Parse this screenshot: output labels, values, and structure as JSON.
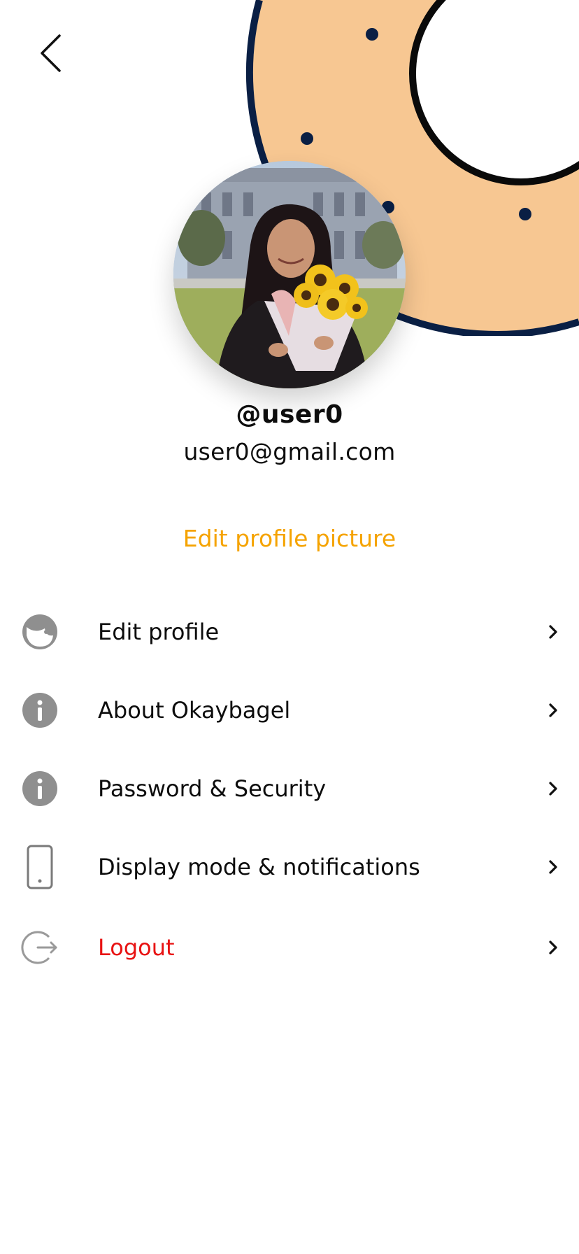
{
  "header": {
    "back_icon": "chevron-left-icon"
  },
  "profile": {
    "username": "@user0",
    "email": "user0@gmail.com",
    "edit_picture_label": "Edit profile picture",
    "avatar_alt": "profile photo"
  },
  "menu": {
    "items": [
      {
        "label": "Edit profile",
        "icon": "face-icon"
      },
      {
        "label": "About Okaybagel",
        "icon": "info-icon"
      },
      {
        "label": "Password & Security",
        "icon": "info-icon"
      },
      {
        "label": "Display mode & notifications",
        "icon": "phone-icon"
      },
      {
        "label": "Logout",
        "icon": "logout-icon"
      }
    ]
  },
  "colors": {
    "accent": "#f5a300",
    "danger": "#e81313",
    "bagel_fill": "#f7c792",
    "bagel_outline": "#0a1f44",
    "icon_gray": "#8f8f8f"
  }
}
